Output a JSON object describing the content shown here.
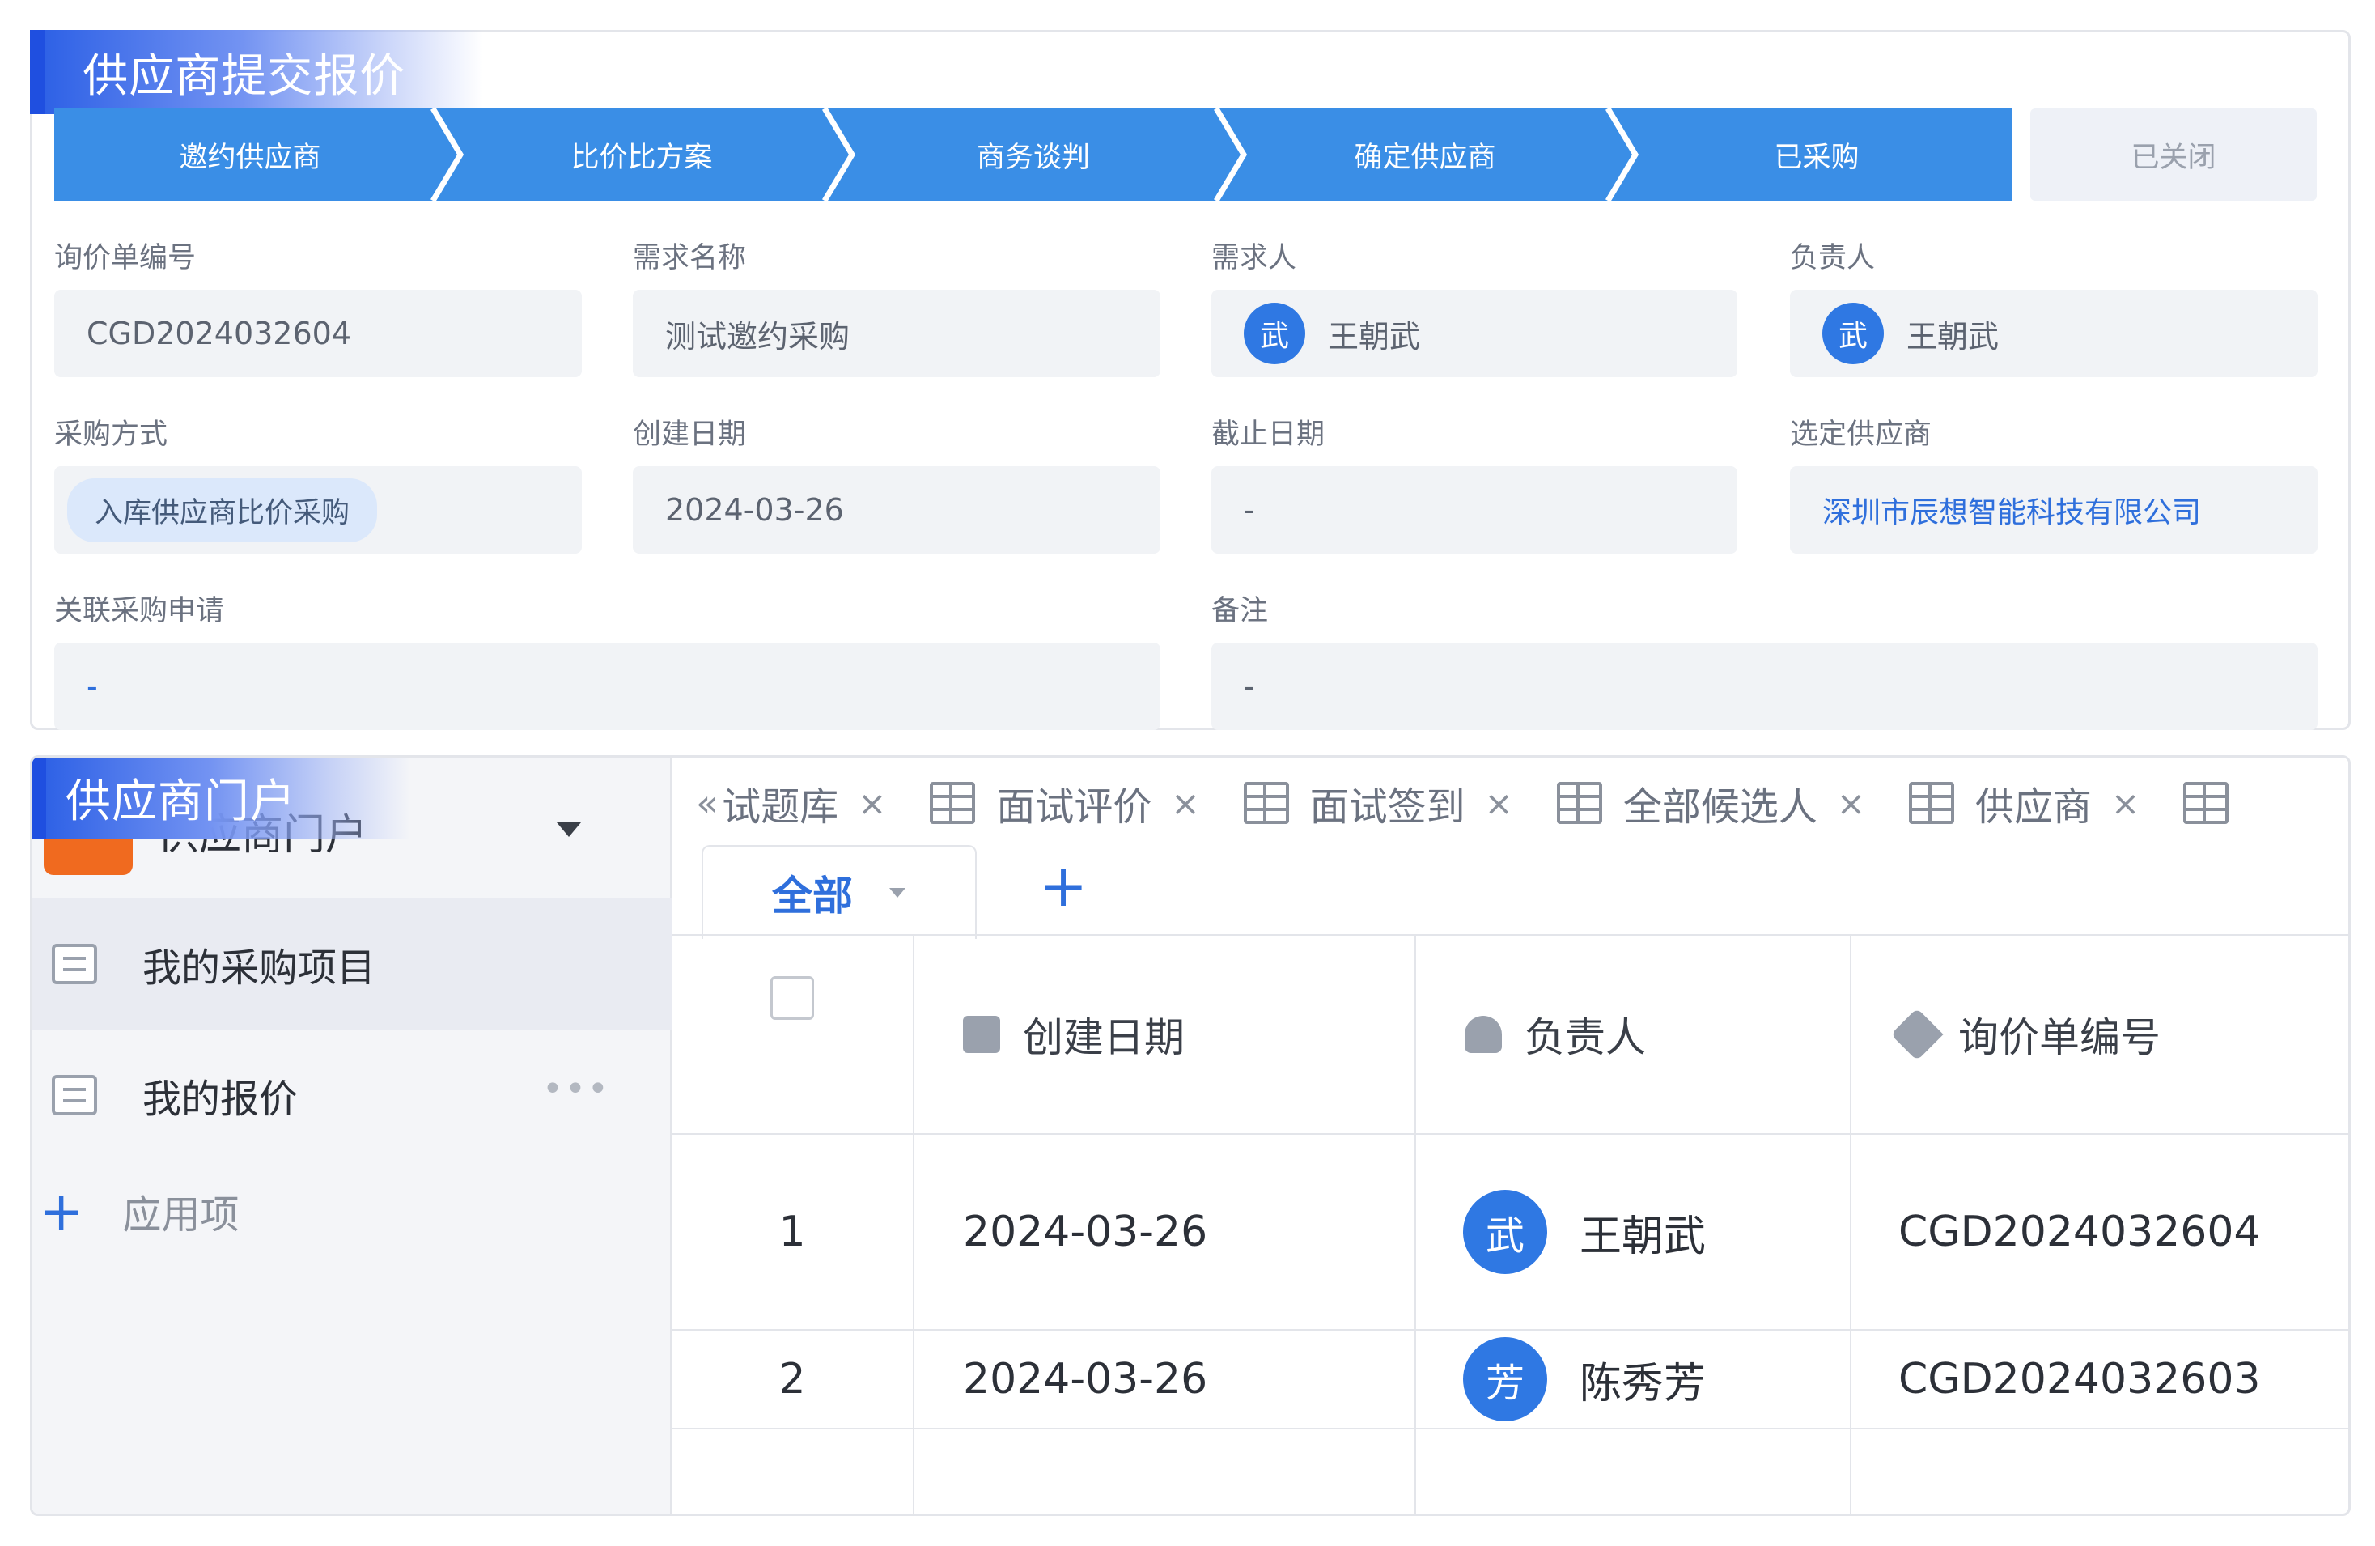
{
  "top_section": {
    "banner_title": "供应商提交报价",
    "steps": [
      "邀约供应商",
      "比价比方案",
      "商务谈判",
      "确定供应商",
      "已采购"
    ],
    "closed_step": "已关闭",
    "fields": {
      "inquiry_no_label": "询价单编号",
      "inquiry_no_value": "CGD2024032604",
      "demand_name_label": "需求名称",
      "demand_name_value": "测试邀约采购",
      "requester_label": "需求人",
      "requester_avatar": "武",
      "requester_name": "王朝武",
      "owner_label": "负责人",
      "owner_avatar": "武",
      "owner_name": "王朝武",
      "purchase_method_label": "采购方式",
      "purchase_method_value": "入库供应商比价采购",
      "created_date_label": "创建日期",
      "created_date_value": "2024-03-26",
      "deadline_label": "截止日期",
      "deadline_value": "-",
      "selected_supplier_label": "选定供应商",
      "selected_supplier_value": "深圳市辰想智能科技有限公司",
      "related_request_label": "关联采购申请",
      "related_request_value": "-",
      "remarks_label": "备注",
      "remarks_value": "-"
    }
  },
  "bottom_section": {
    "banner_title": "供应商门户",
    "sidebar": {
      "app_title": "供应商门户",
      "items": [
        {
          "label": "我的采购项目"
        },
        {
          "label": "我的报价"
        }
      ],
      "add_app_label": "应用项"
    },
    "tabs": [
      {
        "label": "试题库"
      },
      {
        "label": "面试评价"
      },
      {
        "label": "面试签到"
      },
      {
        "label": "全部候选人"
      },
      {
        "label": "供应商"
      }
    ],
    "view_tab_label": "全部",
    "table": {
      "columns": [
        "创建日期",
        "负责人",
        "询价单编号"
      ],
      "rows": [
        {
          "index": "1",
          "created_date": "2024-03-26",
          "owner_avatar": "武",
          "owner_name": "王朝武",
          "inquiry_no": "CGD2024032604"
        },
        {
          "index": "2",
          "created_date": "2024-03-26",
          "owner_avatar": "芳",
          "owner_name": "陈秀芳",
          "inquiry_no": "CGD2024032603"
        }
      ]
    }
  },
  "colors": {
    "accent": "#3a8ee6",
    "link": "#2f6fdc",
    "avatar": "#2f78e3"
  }
}
